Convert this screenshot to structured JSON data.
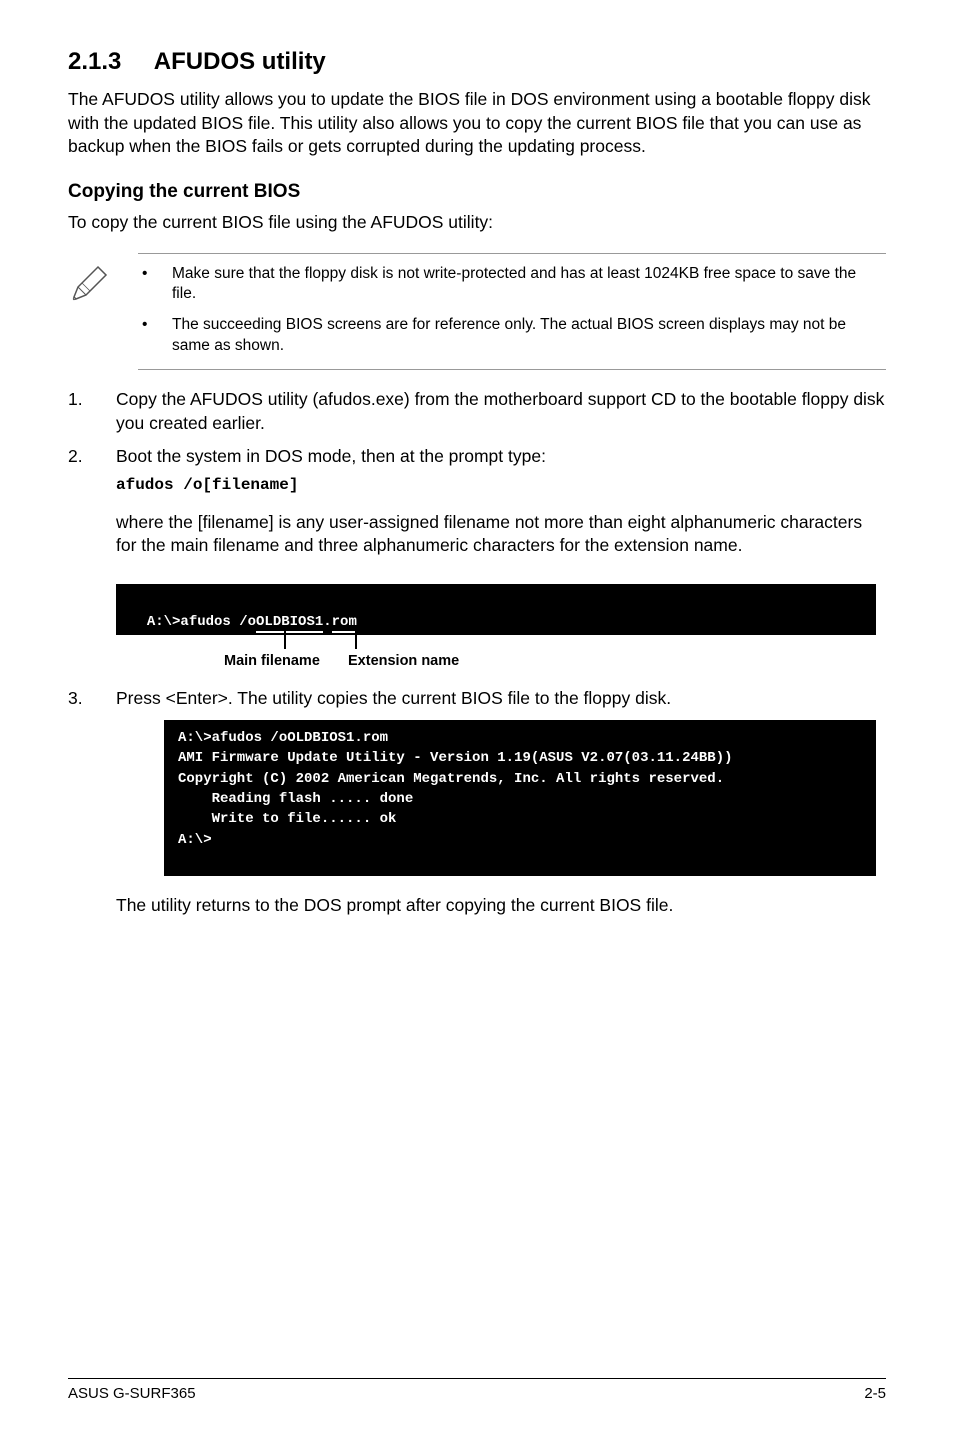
{
  "section": {
    "number": "2.1.3",
    "title": "AFUDOS utility"
  },
  "intro": "The AFUDOS utility allows you to update the BIOS file in DOS environment using a bootable floppy disk with the updated BIOS file. This utility also allows you to copy the current BIOS file that you can use as backup when the BIOS fails or gets corrupted during the updating process.",
  "subheading": "Copying the current BIOS",
  "subintro": "To copy the current BIOS file using the AFUDOS utility:",
  "notes": [
    "Make sure that the floppy disk is not write-protected and has at least 1024KB free space to save the file.",
    "The succeeding BIOS screens are for reference only. The actual BIOS screen displays may not be same as shown."
  ],
  "steps": [
    {
      "num": "1.",
      "text": "Copy the AFUDOS utility (afudos.exe) from the motherboard support CD to the bootable floppy disk you created earlier."
    },
    {
      "num": "2.",
      "text": "Boot the system in DOS mode, then at the prompt type:",
      "code": "afudos /o[filename]"
    }
  ],
  "where_clause": "where the [filename] is any user-assigned filename not more than eight alphanumeric characters  for the main filename and three alphanumeric characters for the extension name.",
  "terminal1": {
    "line": "A:\\>afudos /oOLDBIOS1.rom",
    "main_label": "Main filename",
    "ext_label": "Extension name"
  },
  "step3": {
    "num": "3.",
    "text": "Press <Enter>. The utility copies the current BIOS file to the floppy disk."
  },
  "terminal2": "A:\\>afudos /oOLDBIOS1.rom\nAMI Firmware Update Utility - Version 1.19(ASUS V2.07(03.11.24BB))\nCopyright (C) 2002 American Megatrends, Inc. All rights reserved.\n    Reading flash ..... done\n    Write to file...... ok\nA:\\>\n ",
  "closing": "The utility returns to the DOS prompt after copying the current BIOS file.",
  "footer_left": "ASUS G-SURF365",
  "footer_right": "2-5"
}
